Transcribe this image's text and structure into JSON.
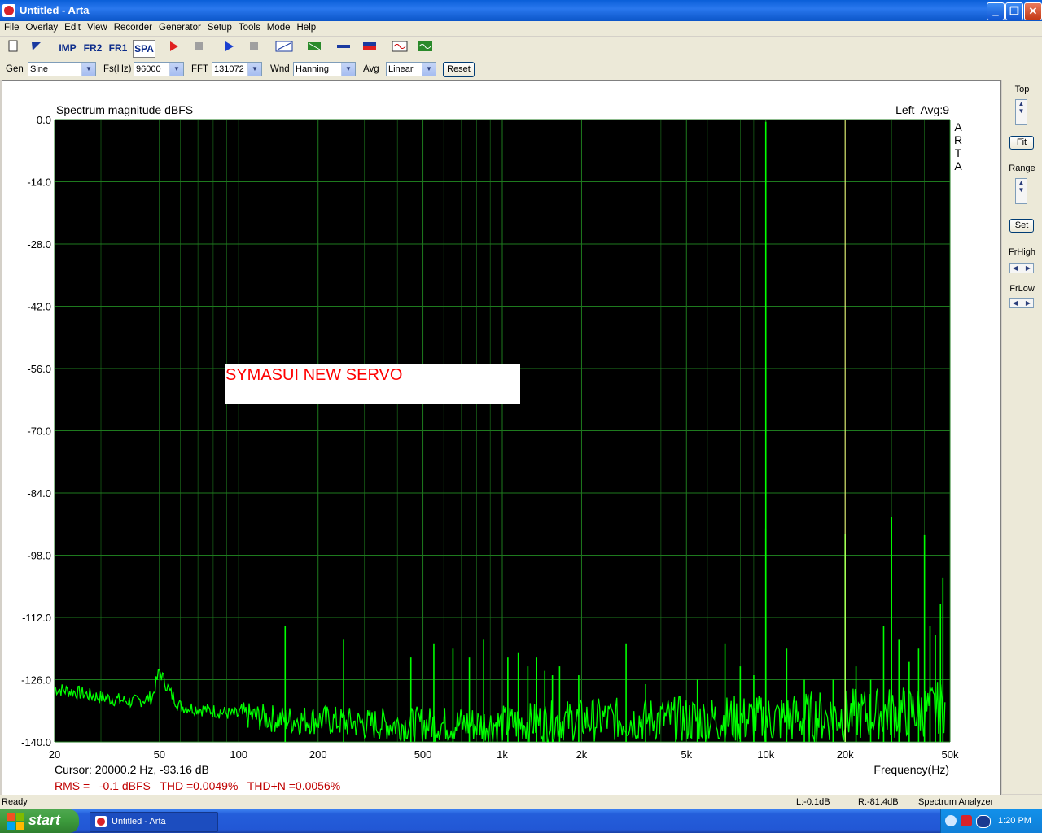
{
  "window": {
    "title": "Untitled - Arta"
  },
  "menu": [
    "File",
    "Overlay",
    "Edit",
    "View",
    "Recorder",
    "Generator",
    "Setup",
    "Tools",
    "Mode",
    "Help"
  ],
  "toolbar": {
    "imp": "IMP",
    "fr2": "FR2",
    "fr1": "FR1",
    "spa": "SPA"
  },
  "controls": {
    "gen_label": "Gen",
    "gen_value": "Sine",
    "fs_label": "Fs(Hz)",
    "fs_value": "96000",
    "fft_label": "FFT",
    "fft_value": "131072",
    "wnd_label": "Wnd",
    "wnd_value": "Hanning",
    "avg_label": "Avg",
    "avg_value": "Linear",
    "reset": "Reset"
  },
  "plot": {
    "title": "Spectrum magnitude dBFS",
    "channel_info": "Left  Avg:9",
    "logo_letters": [
      "A",
      "R",
      "T",
      "A"
    ],
    "annotation": "SYMASUI NEW SERVO",
    "cursor_text": "Cursor: 20000.2 Hz, -93.16 dB",
    "xlabel": "Frequency(Hz)",
    "measurements": "RMS =   -0.1 dBFS   THD =0.0049%   THD+N =0.0056%",
    "colors": {
      "trace": "#00ff00",
      "grid": "#1e7a1e",
      "background": "#000000",
      "cursor": "#ffff80",
      "annotation": "#ff0000",
      "measurements": "#c00000"
    }
  },
  "chart_data": {
    "type": "line",
    "title": "Spectrum magnitude dBFS",
    "xlabel": "Frequency(Hz)",
    "ylabel": "",
    "xscale": "log",
    "xlim": [
      20,
      50000
    ],
    "ylim": [
      -140,
      0
    ],
    "x_tick_labels": [
      "20",
      "50",
      "100",
      "200",
      "500",
      "1k",
      "2k",
      "5k",
      "10k",
      "20k",
      "50k"
    ],
    "x_ticks": [
      20,
      50,
      100,
      200,
      500,
      1000,
      2000,
      5000,
      10000,
      20000,
      50000
    ],
    "y_ticks": [
      0,
      -14,
      -28,
      -42,
      -56,
      -70,
      -84,
      -98,
      -112,
      -126,
      -140
    ],
    "y_tick_labels": [
      "0.0",
      "-14.0",
      "-28.0",
      "-42.0",
      "-56.0",
      "-70.0",
      "-84.0",
      "-98.0",
      "-112.0",
      "-126.0",
      "-140.0"
    ],
    "grid": true,
    "cursor_x": 20000,
    "noise_floor": [
      [
        20,
        -128
      ],
      [
        25,
        -129
      ],
      [
        30,
        -130
      ],
      [
        40,
        -131
      ],
      [
        47,
        -130
      ],
      [
        50,
        -124
      ],
      [
        55,
        -129
      ],
      [
        60,
        -132
      ],
      [
        80,
        -133
      ],
      [
        100,
        -134
      ],
      [
        150,
        -135
      ],
      [
        200,
        -135
      ],
      [
        300,
        -136
      ],
      [
        500,
        -136
      ],
      [
        1000,
        -136
      ],
      [
        2000,
        -135
      ],
      [
        5000,
        -135
      ],
      [
        10000,
        -135
      ],
      [
        20000,
        -134
      ],
      [
        40000,
        -133
      ],
      [
        48000,
        -132
      ]
    ],
    "peaks": [
      [
        10000,
        -0.5
      ],
      [
        20000,
        -93.2
      ],
      [
        30000,
        -89.5
      ],
      [
        40000,
        -93.5
      ],
      [
        47000,
        -103
      ],
      [
        10000,
        -92
      ],
      [
        150,
        -114
      ],
      [
        250,
        -117
      ],
      [
        450,
        -121
      ],
      [
        550,
        -118
      ],
      [
        650,
        -119
      ],
      [
        750,
        -121
      ],
      [
        850,
        -117
      ],
      [
        1050,
        -121
      ],
      [
        1150,
        -120
      ],
      [
        1250,
        -123
      ],
      [
        1350,
        -121
      ],
      [
        1450,
        -124
      ],
      [
        1550,
        -125
      ],
      [
        1650,
        -123
      ],
      [
        1950,
        -125
      ],
      [
        2950,
        -118
      ],
      [
        3500,
        -127
      ],
      [
        5500,
        -126
      ],
      [
        7000,
        -118
      ],
      [
        8000,
        -123
      ],
      [
        9000,
        -125
      ],
      [
        12000,
        -119
      ],
      [
        14000,
        -126
      ],
      [
        18000,
        -126
      ],
      [
        22000,
        -123
      ],
      [
        25000,
        -126
      ],
      [
        28000,
        -114
      ],
      [
        32000,
        -117
      ],
      [
        35000,
        -122
      ],
      [
        38000,
        -119
      ],
      [
        42000,
        -114
      ],
      [
        44000,
        -116
      ],
      [
        46000,
        -109
      ]
    ],
    "series": [
      {
        "name": "Left",
        "color": "#00ff00"
      }
    ]
  },
  "right_panel": {
    "top": "Top",
    "fit": "Fit",
    "range": "Range",
    "set": "Set",
    "frhigh": "FrHigh",
    "frlow": "FrLow"
  },
  "status": {
    "left": "Ready",
    "l_level": "L:-0.1dB",
    "r_level": "R:-81.4dB",
    "mode": "Spectrum Analyzer"
  },
  "taskbar": {
    "start": "start",
    "item": "Untitled - Arta",
    "clock": "1:20 PM"
  }
}
